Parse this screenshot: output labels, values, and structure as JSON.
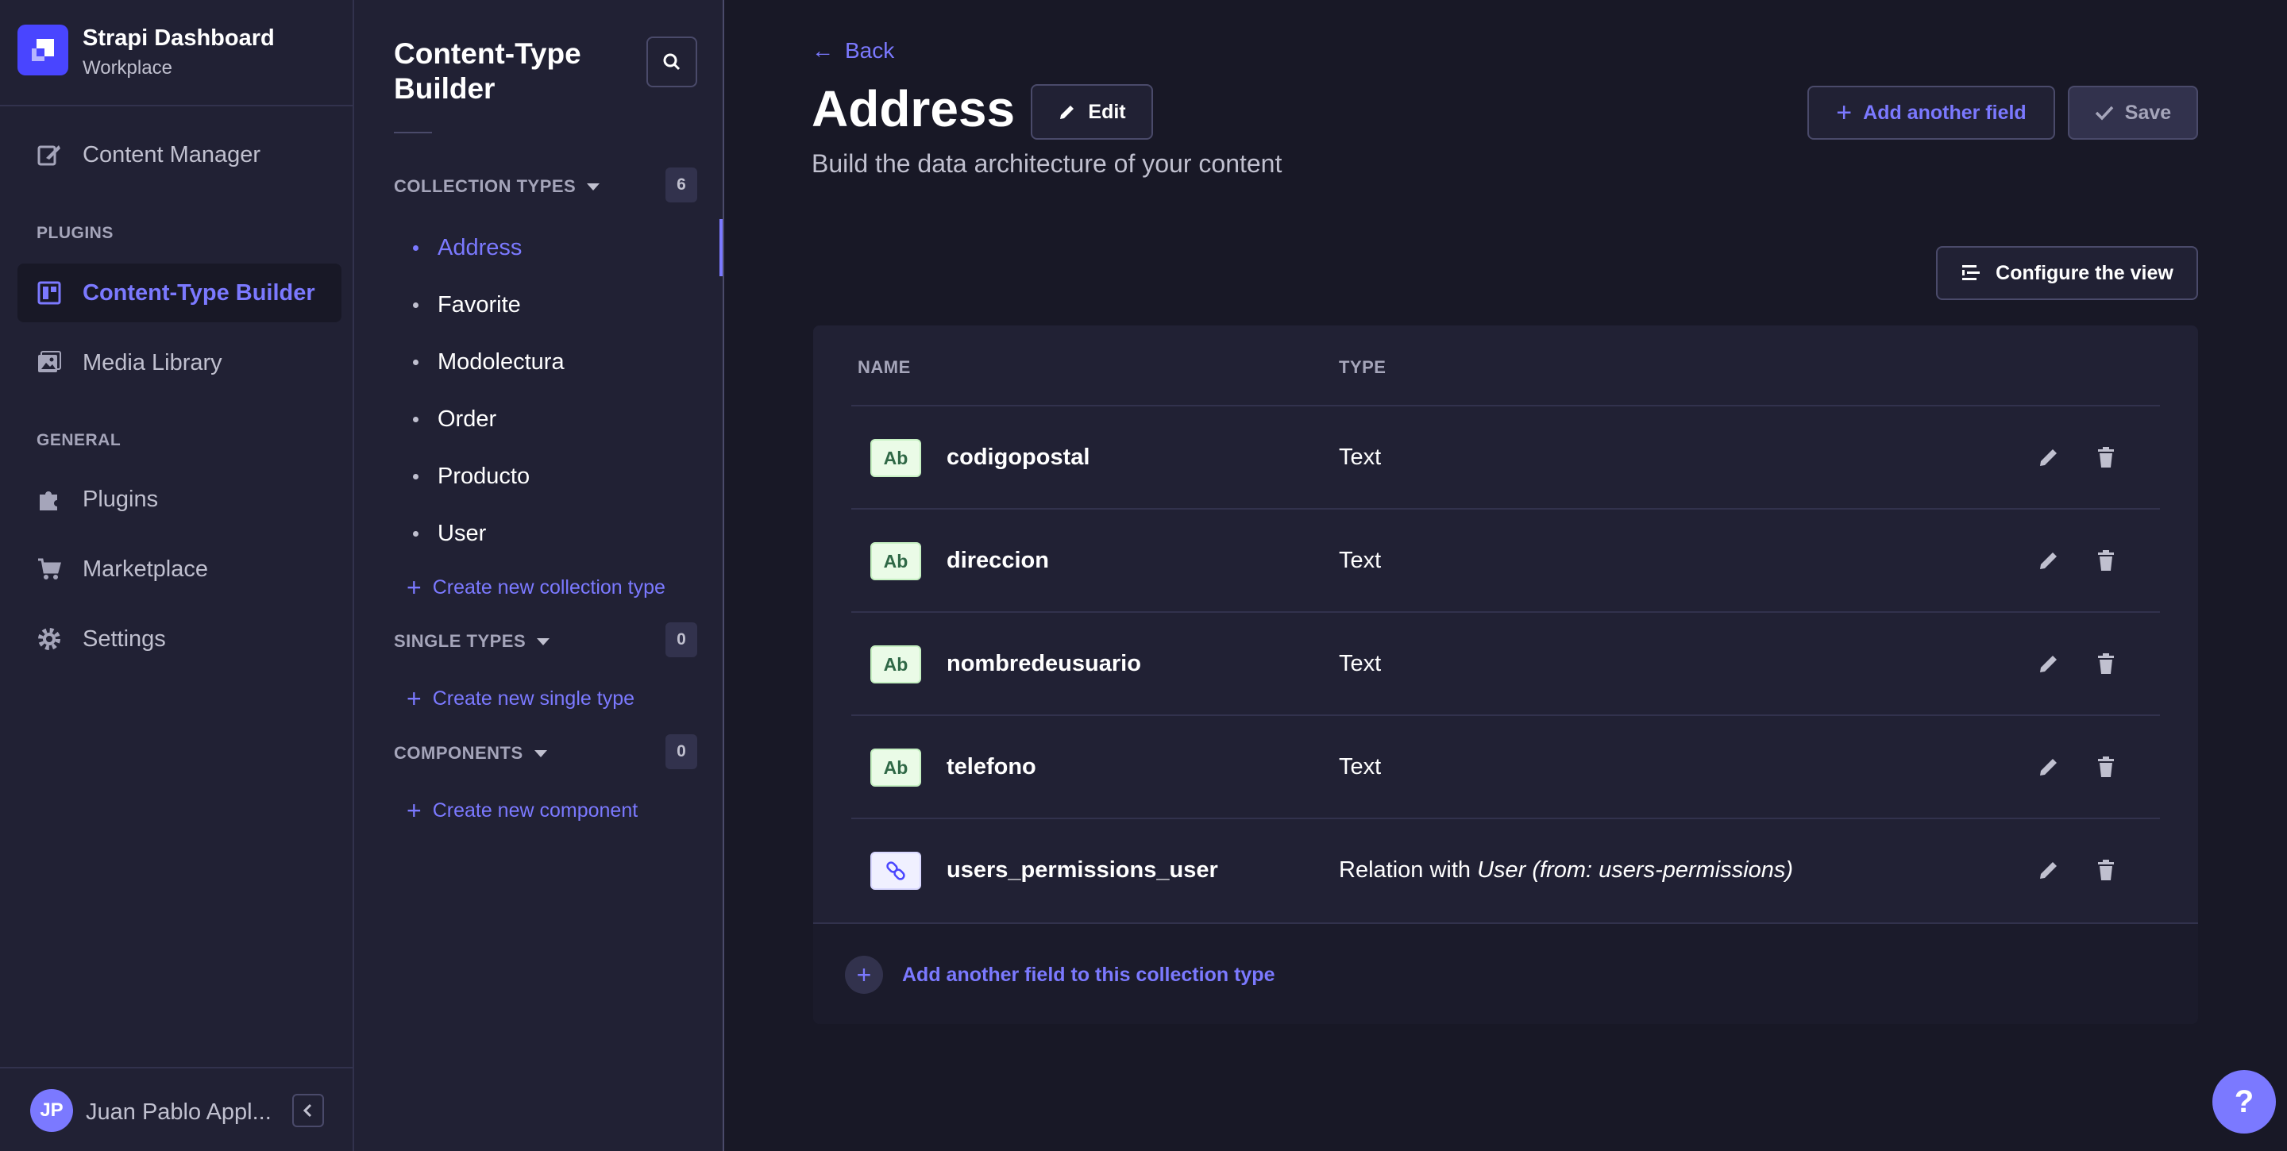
{
  "brand": {
    "title": "Strapi Dashboard",
    "subtitle": "Workplace",
    "accent": "#4945ff"
  },
  "nav": {
    "content_manager": "Content Manager",
    "plugins_section": "PLUGINS",
    "content_type_builder": "Content-Type Builder",
    "media_library": "Media Library",
    "general_section": "GENERAL",
    "plugins": "Plugins",
    "marketplace": "Marketplace",
    "settings": "Settings"
  },
  "user": {
    "initials": "JP",
    "name": "Juan Pablo Appl..."
  },
  "subnav": {
    "title": "Content-Type Builder",
    "collection_types": {
      "label": "COLLECTION TYPES",
      "count": "6",
      "items": [
        "Address",
        "Favorite",
        "Modolectura",
        "Order",
        "Producto",
        "User"
      ],
      "active": "Address",
      "create": "Create new collection type"
    },
    "single_types": {
      "label": "SINGLE TYPES",
      "count": "0",
      "create": "Create new single type"
    },
    "components": {
      "label": "COMPONENTS",
      "count": "0",
      "create": "Create new component"
    }
  },
  "main": {
    "back": "Back",
    "title": "Address",
    "edit": "Edit",
    "subtitle": "Build the data architecture of your content",
    "add_field": "Add another field",
    "save": "Save",
    "configure": "Configure the view"
  },
  "table": {
    "headers": {
      "name": "NAME",
      "type": "TYPE"
    },
    "rows": [
      {
        "badge": "Ab",
        "name": "codigopostal",
        "type": "Text"
      },
      {
        "badge": "Ab",
        "name": "direccion",
        "type": "Text"
      },
      {
        "badge": "Ab",
        "name": "nombredeusuario",
        "type": "Text"
      },
      {
        "badge": "Ab",
        "name": "telefono",
        "type": "Text"
      },
      {
        "badge": "link-icon",
        "name": "users_permissions_user",
        "type_prefix": "Relation with",
        "type_italic": "User (from: users-permissions)"
      }
    ],
    "footer": "Add another field to this collection type"
  },
  "help": "?"
}
